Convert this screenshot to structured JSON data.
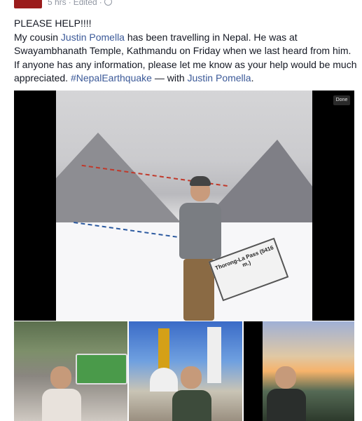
{
  "post": {
    "meta": {
      "time": "5 hrs",
      "edited": "Edited"
    },
    "headline": "PLEASE HELP!!!!",
    "body": {
      "part1": "My cousin ",
      "mention1": "Justin Pomella",
      "part2": " has been travelling in Nepal. He was at Swayambhanath Temple, Kathmandu on Friday when we last heard from him. If anyone has any information, please let me know as your help would be much appreciated. ",
      "hashtag": "#NepalEarthquake",
      "with_text": " — with ",
      "mention2": "Justin Pomella",
      "end": "."
    }
  },
  "media": {
    "done_label": "Done",
    "sign_text": "Thorong-La Pass (5416 m.)"
  },
  "icons": {
    "privacy": "globe-icon",
    "avatar": "profile-picture"
  },
  "colors": {
    "link": "#3b5998",
    "meta": "#9197a3",
    "text": "#141823"
  }
}
